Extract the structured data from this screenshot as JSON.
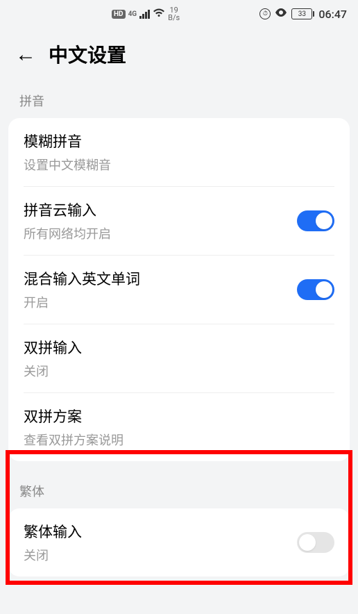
{
  "status_bar": {
    "hd_badge": "HD",
    "network_type": "4G",
    "speed_value": "19",
    "speed_unit": "B/s",
    "battery_percent": "33",
    "time": "06:47"
  },
  "header": {
    "title": "中文设置"
  },
  "sections": {
    "pinyin": {
      "header": "拼音",
      "items": [
        {
          "title": "模糊拼音",
          "subtitle": "设置中文模糊音",
          "has_toggle": false
        },
        {
          "title": "拼音云输入",
          "subtitle": "所有网络均开启",
          "has_toggle": true,
          "toggle_on": true
        },
        {
          "title": "混合输入英文单词",
          "subtitle": "开启",
          "has_toggle": true,
          "toggle_on": true
        },
        {
          "title": "双拼输入",
          "subtitle": "关闭",
          "has_toggle": false
        },
        {
          "title": "双拼方案",
          "subtitle": "查看双拼方案说明",
          "has_toggle": false
        }
      ]
    },
    "fanti": {
      "header": "繁体",
      "items": [
        {
          "title": "繁体输入",
          "subtitle": "关闭",
          "has_toggle": true,
          "toggle_on": false
        }
      ]
    }
  }
}
